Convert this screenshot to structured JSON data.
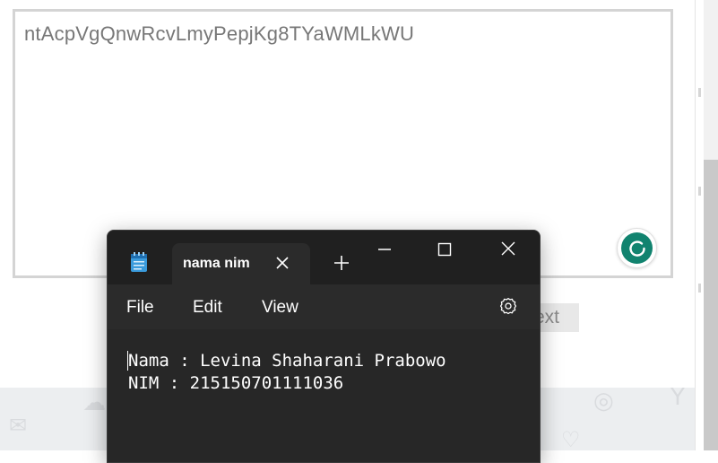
{
  "page": {
    "textarea_value": "ntAcpVgQnwRcvLmyPepjKg8TYaWMLkWU",
    "text_chip_label": "ext"
  },
  "notepad": {
    "tab_title": "nama nim",
    "menu": {
      "file": "File",
      "edit": "Edit",
      "view": "View"
    },
    "content_lines": [
      "Nama : Levina Shaharani Prabowo",
      "NIM : 215150701111036"
    ]
  },
  "colors": {
    "notepad_bg": "#202020",
    "notepad_editor_bg": "#272727",
    "grammarly_green": "#11836f"
  }
}
